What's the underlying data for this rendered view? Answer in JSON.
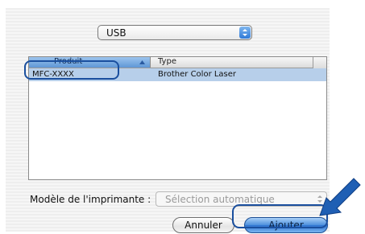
{
  "connection_select": {
    "value": "USB"
  },
  "printer_list": {
    "columns": [
      "Produit",
      "Type"
    ],
    "rows": [
      {
        "produit": "MFC-XXXX",
        "type": "Brother Color Laser"
      }
    ]
  },
  "model": {
    "label": "Modèle de l'imprimante :",
    "value": "Sélection automatique"
  },
  "buttons": {
    "cancel": "Annuler",
    "add": "Ajouter"
  },
  "colors": {
    "accent": "#1a4f9e",
    "selection": "#b7cfea",
    "default_button": "#4c8fdc"
  }
}
